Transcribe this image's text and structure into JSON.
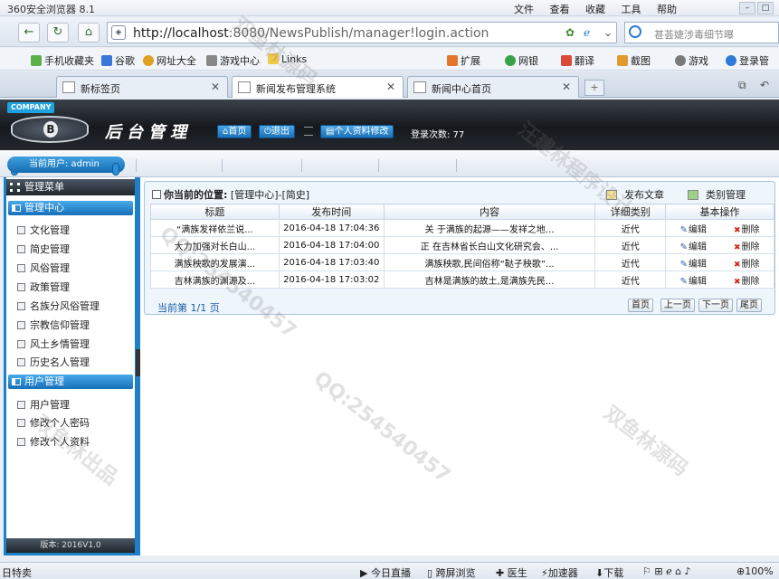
{
  "browser": {
    "window_title": "360安全浏览器 8.1",
    "menu": [
      "文件",
      "查看",
      "收藏",
      "工具",
      "帮助"
    ],
    "url_host": "http://localhost",
    "url_path": ":8080/NewsPublish/manager!login.action",
    "search_placeholder": "甚荟婕涉毒细节曝",
    "favorites": [
      "手机收藏夹",
      "谷歌",
      "网址大全",
      "游戏中心",
      "Links",
      "扩展",
      "网银",
      "翻译",
      "截图",
      "游戏",
      "登录管"
    ],
    "tabs": [
      {
        "label": "新标签页",
        "active": false
      },
      {
        "label": "新闻发布管理系统",
        "active": true
      },
      {
        "label": "新闻中心首页",
        "active": false
      }
    ],
    "new_tab_label": "+"
  },
  "header": {
    "company_badge": "COMPANY",
    "title": "后台管理",
    "home_btn": "首页",
    "logout_btn": "退出",
    "profile_btn": "个人资料修改",
    "login_count": "登录次数: 77"
  },
  "userbar": {
    "current_user": "当前用户: admin"
  },
  "sidebar": {
    "menu_title": "管理菜单",
    "groups": [
      {
        "title": "管理中心",
        "items": [
          "文化管理",
          "简史管理",
          "风俗管理",
          "政策管理",
          "名族分风俗管理",
          "宗教信仰管理",
          "风土乡情管理",
          "历史名人管理"
        ]
      },
      {
        "title": "用户管理",
        "items": [
          "用户管理",
          "修改个人密码",
          "修改个人资料"
        ]
      }
    ],
    "version": "版本: 2016V1.0"
  },
  "main": {
    "location_label": "你当前的位置:",
    "location_value": "[管理中心]-[简史]",
    "publish_btn": "发布文章",
    "category_btn": "类别管理",
    "columns": [
      "标题",
      "发布时间",
      "内容",
      "详细类别",
      "基本操作"
    ],
    "rows": [
      {
        "title": "“满族发祥依兰说...",
        "time": "2016-04-18 17:04:36",
        "content": "关 于满族的起源——发祥之地...",
        "category": "近代"
      },
      {
        "title": "大力加强对长白山...",
        "time": "2016-04-18 17:04:00",
        "content": "正 在吉林省长白山文化研究会、...",
        "category": "近代"
      },
      {
        "title": "满族秧歌的发展演...",
        "time": "2016-04-18 17:03:40",
        "content": "满族秧歌,民间俗称“鞑子秧歌”...",
        "category": "近代"
      },
      {
        "title": "吉林满族的渊源及...",
        "time": "2016-04-18 17:03:02",
        "content": "吉林是满族的故土,是满族先民...",
        "category": "近代"
      }
    ],
    "edit_label": "编辑",
    "delete_label": "删除",
    "page_info": "当前第 1/1 页",
    "pager": [
      "首页",
      "上一页",
      "下一页",
      "尾页"
    ]
  },
  "statusbar": {
    "left": "日特卖",
    "items": [
      "今日直播",
      "跨屏浏览",
      "医生",
      "加速器",
      "下载"
    ],
    "zoom": "100%"
  },
  "watermarks": [
    "双鱼林源码",
    "汪建林程序设计",
    "QQ:254540457",
    "双鱼林出品"
  ],
  "colors": {
    "accent_blue": "#1d7fc6",
    "header_dark": "#15191e",
    "delete_red": "#d2271b"
  }
}
